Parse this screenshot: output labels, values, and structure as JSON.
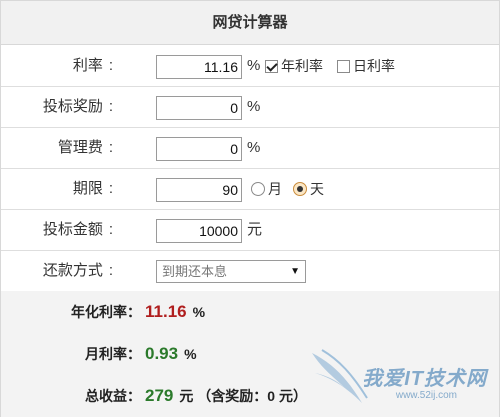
{
  "title": "网贷计算器",
  "rows": {
    "rate": {
      "label": "利率",
      "colon": ":",
      "value": "11.16",
      "unit": "%",
      "opt1": "年利率",
      "opt2": "日利率"
    },
    "bonus": {
      "label": "投标奖励",
      "colon": ":",
      "value": "0",
      "unit": "%"
    },
    "fee": {
      "label": "管理费",
      "colon": ":",
      "value": "0",
      "unit": "%"
    },
    "term": {
      "label": "期限",
      "colon": ":",
      "value": "90",
      "opt1": "月",
      "opt2": "天"
    },
    "amount": {
      "label": "投标金额",
      "colon": ":",
      "value": "10000",
      "unit": "元"
    },
    "repay": {
      "label": "还款方式",
      "colon": ":",
      "selected": "到期还本息",
      "arrow": "▼"
    }
  },
  "results": {
    "annual": {
      "label": "年化利率：",
      "value": "11.16",
      "suffix": "%"
    },
    "monthly": {
      "label": "月利率：",
      "value": "0.93",
      "suffix": "%"
    },
    "total": {
      "label": "总收益：",
      "value": "279",
      "suffix": "元 （含奖励：0 元）"
    }
  },
  "watermark": {
    "text": "我爱IT技术网",
    "sub": "www.52ij.com"
  },
  "colors": {
    "red_value": "#b01e1e",
    "green_value": "#2b7a2b",
    "header_bg": "#f1f1f1"
  },
  "state": {
    "rate_annual_checked": true,
    "rate_daily_checked": false,
    "term_month_checked": false,
    "term_day_checked": true
  }
}
